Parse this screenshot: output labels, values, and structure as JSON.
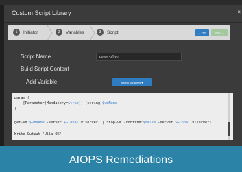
{
  "topstrip": {
    "text": "…"
  },
  "modal": {
    "title": "Custom Script Library",
    "close_label": "×"
  },
  "wizard": {
    "steps": [
      {
        "number": "1",
        "label": "Initiator"
      },
      {
        "number": "2",
        "label": "Variables"
      },
      {
        "number": "3",
        "label": "Script"
      }
    ],
    "prev_label": "← Prev",
    "next_label": "Next →"
  },
  "form": {
    "script_name_label": "Script Name",
    "script_name_value": "power-off-vm",
    "build_label": "Build Script Content",
    "add_variable_label": "Add Variable",
    "select_variables_label": "Select Variables ▾"
  },
  "editor": {
    "lines": [
      "param (",
      "    [Parameter(Mandatory=$true)] [string]$vmName",
      ")",
      "get-vm $vmName -server $Global:viserver1 | Stop-vm -confirm:$false -server $Global:viserver1",
      "Write-Output \"Ulla_OK\""
    ]
  },
  "footer": {
    "title": "AIOPS Remediations"
  },
  "colors": {
    "accent_blue": "#2f7cc1",
    "footer_teal": "#2b84a8",
    "next_green": "#a4c9a1"
  }
}
